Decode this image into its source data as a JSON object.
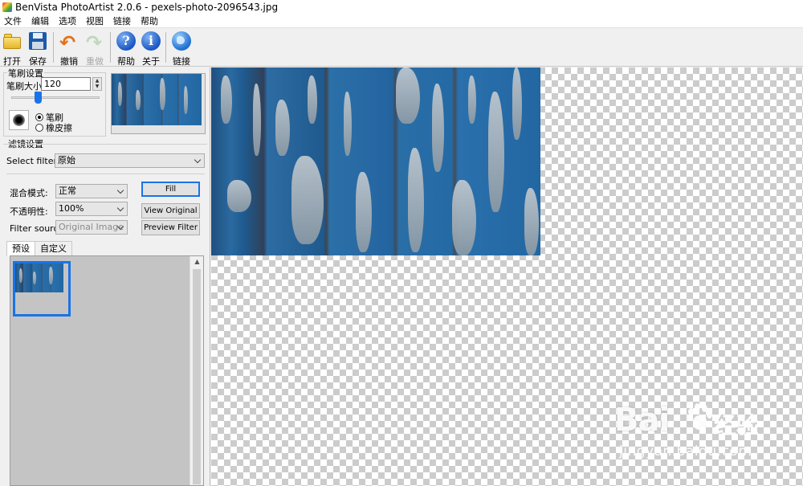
{
  "window": {
    "title": "BenVista PhotoArtist 2.0.6 - pexels-photo-2096543.jpg"
  },
  "menu": [
    "文件",
    "编辑",
    "选项",
    "视图",
    "链接",
    "帮助"
  ],
  "toolbar": {
    "open": "打开",
    "save": "保存",
    "undo": "撤销",
    "redo": "重做",
    "help": "帮助",
    "about": "关于",
    "link": "链接",
    "help_glyph": "?",
    "about_glyph": "i"
  },
  "brush": {
    "group_title": "笔刷设置",
    "size_label": "笔刷大小:",
    "size_value": "120",
    "mode_brush": "笔刷",
    "mode_eraser": "橡皮擦",
    "selected_mode": "笔刷",
    "slider_level": 0.3
  },
  "filter": {
    "group_title": "滤镜设置",
    "select_label": "Select filter:",
    "selected": "原始",
    "blend_label": "混合模式:",
    "blend_value": "正常",
    "opacity_label": "不透明性:",
    "opacity_value": "100%",
    "source_label": "Filter source:",
    "source_value": "Original Image",
    "fill_button": "Fill",
    "view_original_button": "View Original",
    "preview_filter_button": "Preview Filter"
  },
  "tabs": [
    {
      "label": "预设",
      "active": true
    },
    {
      "label": "自定义",
      "active": false
    }
  ],
  "colors": {
    "accent": "#1a73e8",
    "canvas_check": "#cccccc"
  },
  "watermark": {
    "logo_left": "Bai",
    "logo_right": "经验",
    "url": "jingyan.baidu.com"
  }
}
